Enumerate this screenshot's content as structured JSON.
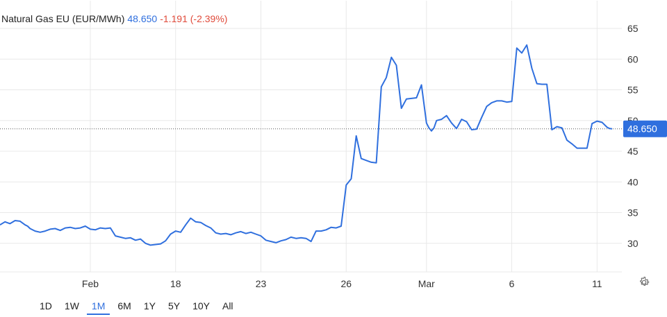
{
  "legend": {
    "name": "Natural Gas EU (EUR/MWh)",
    "price": "48.650",
    "change": "-1.191 (-2.39%)"
  },
  "colors": {
    "line": "#2f6fde",
    "grid": "#e8e8e8",
    "text": "#333333",
    "negative": "#e04a3a",
    "badge": "#2f6fde"
  },
  "range_buttons": [
    {
      "label": "1D",
      "active": false
    },
    {
      "label": "1W",
      "active": false
    },
    {
      "label": "1M",
      "active": true
    },
    {
      "label": "6M",
      "active": false
    },
    {
      "label": "1Y",
      "active": false
    },
    {
      "label": "5Y",
      "active": false
    },
    {
      "label": "10Y",
      "active": false
    },
    {
      "label": "All",
      "active": false
    }
  ],
  "settings_icon": "gear-icon",
  "chart_data": {
    "type": "line",
    "title": "Natural Gas EU (EUR/MWh)",
    "xlabel": "",
    "ylabel": "",
    "ylim": [
      25,
      68
    ],
    "yticks": [
      30,
      35,
      40,
      45,
      50,
      55,
      60,
      65
    ],
    "x_tick_labels": [
      {
        "label": "Feb",
        "x": 13
      },
      {
        "label": "18",
        "x": 30
      },
      {
        "label": "23",
        "x": 47
      },
      {
        "label": "26",
        "x": 64
      },
      {
        "label": "Mar",
        "x": 80
      },
      {
        "label": "6",
        "x": 97
      },
      {
        "label": "11",
        "x": 114
      }
    ],
    "xlim": [
      -5,
      119
    ],
    "current_value": 48.65,
    "current_label": "48.650",
    "grid": true,
    "series": [
      {
        "x": [
          -5,
          -4,
          -3,
          -2,
          -1,
          0,
          0.5,
          1,
          2,
          3,
          4,
          5,
          6,
          7,
          8,
          9,
          10,
          11,
          12,
          13,
          14,
          15,
          16,
          17,
          18,
          19,
          20,
          21,
          22,
          23,
          24,
          25,
          26,
          27,
          28,
          29,
          30,
          31,
          32,
          33,
          34,
          35,
          36,
          37,
          38,
          39,
          40,
          41,
          42,
          43,
          44,
          45,
          46,
          47,
          48,
          49,
          50,
          51,
          52,
          53,
          54,
          55,
          56,
          57,
          58,
          59,
          60,
          61,
          62,
          63,
          64,
          65,
          66,
          67,
          68,
          69,
          70,
          71,
          72,
          73,
          74,
          75,
          76,
          77,
          78,
          79,
          80,
          80.5,
          81,
          81.5,
          82,
          83,
          84,
          85,
          86,
          87,
          88,
          89,
          90,
          91,
          92,
          93,
          94,
          95,
          96,
          97,
          98,
          99,
          100,
          101,
          102,
          103,
          104,
          105,
          106,
          107,
          108,
          109,
          110,
          111,
          112,
          113,
          114,
          115,
          116,
          116.5,
          117
        ],
        "y": [
          33.0,
          33.5,
          33.2,
          33.7,
          33.6,
          33.0,
          32.8,
          32.4,
          32.0,
          31.8,
          32.0,
          32.3,
          32.4,
          32.1,
          32.5,
          32.6,
          32.4,
          32.5,
          32.8,
          32.3,
          32.2,
          32.5,
          32.4,
          32.5,
          31.2,
          31.0,
          30.8,
          30.9,
          30.5,
          30.7,
          30.0,
          29.7,
          29.8,
          29.9,
          30.4,
          31.5,
          32.0,
          31.8,
          33.0,
          34.1,
          33.5,
          33.4,
          32.9,
          32.5,
          31.7,
          31.5,
          31.6,
          31.4,
          31.7,
          31.9,
          31.6,
          31.8,
          31.5,
          31.2,
          30.5,
          30.3,
          30.1,
          30.4,
          30.6,
          31.0,
          30.8,
          30.9,
          30.8,
          30.3,
          32.0,
          32.0,
          32.2,
          32.6,
          32.5,
          32.8,
          39.5,
          40.5,
          47.5,
          43.8,
          43.5,
          43.2,
          43.1,
          55.5,
          57.0,
          60.3,
          59.0,
          52.0,
          53.5,
          53.6,
          53.7,
          55.8,
          49.6,
          48.8,
          48.3,
          48.8,
          50.0,
          50.2,
          50.8,
          49.6,
          48.7,
          50.2,
          49.8,
          48.5,
          48.6,
          50.5,
          52.3,
          52.9,
          53.2,
          53.2,
          53.0,
          53.1,
          61.8,
          61.0,
          62.3,
          58.5,
          56.0,
          55.9,
          55.9,
          48.5,
          49.0,
          48.8,
          46.8,
          46.2,
          45.5,
          45.5,
          45.5,
          49.5,
          49.9,
          49.7,
          48.9,
          48.7,
          48.65
        ]
      }
    ]
  }
}
